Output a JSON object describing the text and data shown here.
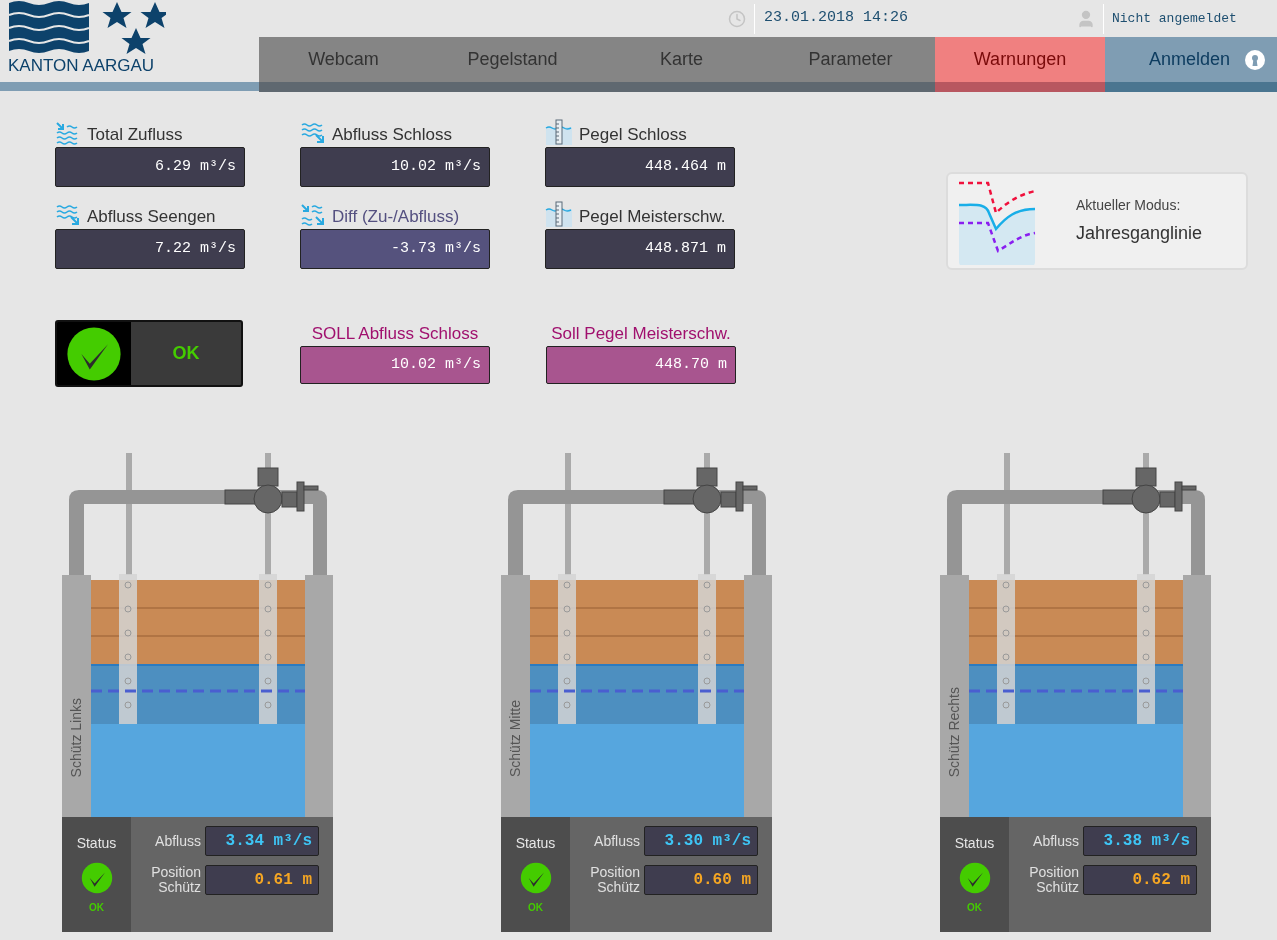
{
  "header": {
    "logo_text": "KANTON AARGAU",
    "datetime": "23.01.2018 14:26",
    "user": "Nicht angemeldet"
  },
  "nav": [
    {
      "label": "Webcam",
      "kind": "normal"
    },
    {
      "label": "Pegelstand",
      "kind": "normal"
    },
    {
      "label": "Karte",
      "kind": "normal"
    },
    {
      "label": "Parameter",
      "kind": "normal"
    },
    {
      "label": "Warnungen",
      "kind": "warning"
    },
    {
      "label": "Anmelden",
      "kind": "login"
    }
  ],
  "metrics": [
    {
      "label": "Total Zufluss",
      "value": "6.29 m³/s",
      "kind": "inflow"
    },
    {
      "label": "Abfluss Schloss",
      "value": "10.02 m³/s",
      "kind": "outflow"
    },
    {
      "label": "Pegel Schloss",
      "value": "448.464 m",
      "kind": "gauge"
    },
    {
      "label": "Abfluss Seengen",
      "value": "7.22 m³/s",
      "kind": "outflow"
    },
    {
      "label": "Diff (Zu-/Abfluss)",
      "value": "-3.73 m³/s",
      "kind": "diff"
    },
    {
      "label": "Pegel Meisterschw.",
      "value": "448.871 m",
      "kind": "gauge"
    }
  ],
  "status": {
    "label": "OK",
    "ok": true
  },
  "targets": [
    {
      "label": "SOLL Abfluss Schloss",
      "value": "10.02 m³/s"
    },
    {
      "label": "Soll Pegel Meisterschw.",
      "value": "448.70 m"
    }
  ],
  "mode": {
    "label": "Aktueller Modus:",
    "value": "Jahresganglinie"
  },
  "gates": [
    {
      "name": "Schütz Links",
      "status_label": "Status",
      "status": "OK",
      "ok": true,
      "flow_label": "Abfluss",
      "flow": "3.34 m³/s",
      "position_label": "Position Schütz",
      "position": "0.61 m"
    },
    {
      "name": "Schütz Mitte",
      "status_label": "Status",
      "status": "OK",
      "ok": true,
      "flow_label": "Abfluss",
      "flow": "3.30 m³/s",
      "position_label": "Position Schütz",
      "position": "0.60 m"
    },
    {
      "name": "Schütz Rechts",
      "status_label": "Status",
      "status": "OK",
      "ok": true,
      "flow_label": "Abfluss",
      "flow": "3.38 m³/s",
      "position_label": "Position Schütz",
      "position": "0.62 m"
    }
  ]
}
